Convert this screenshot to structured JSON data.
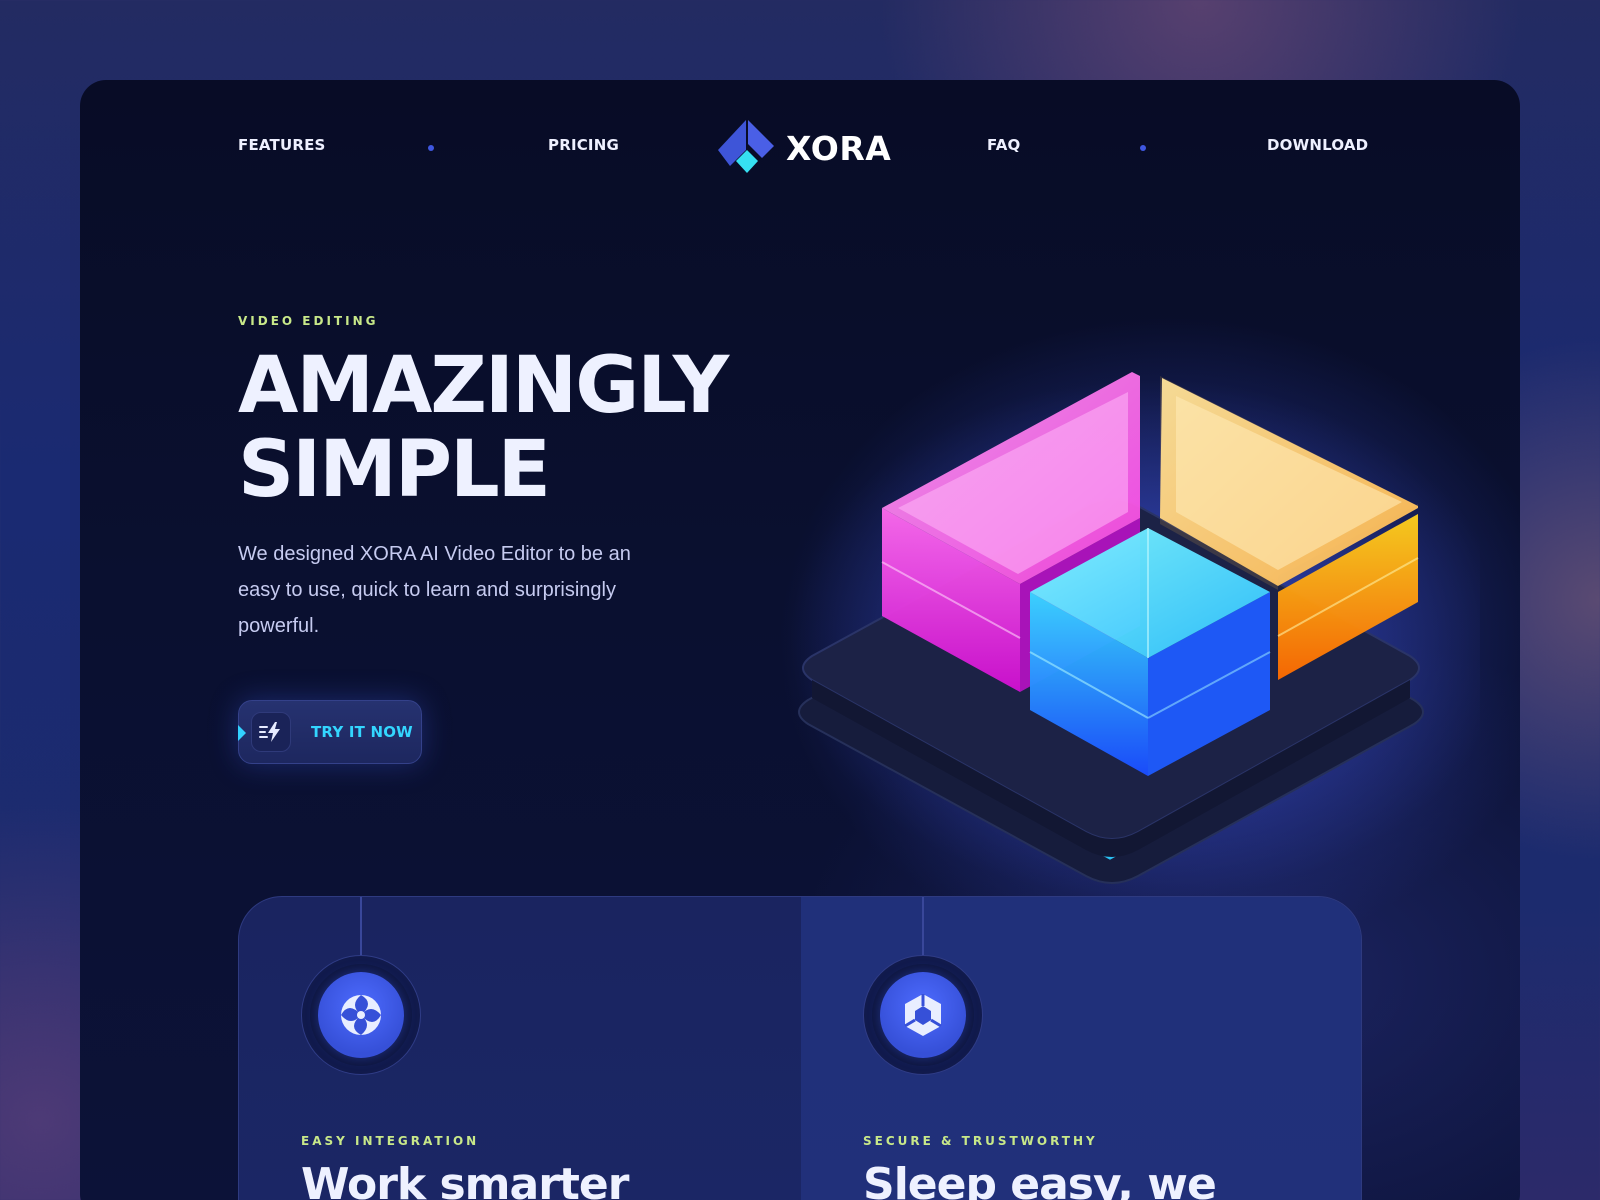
{
  "brand": {
    "name": "XORA",
    "icon": "xora-diamond-logo"
  },
  "nav": {
    "items": [
      {
        "label": "FEATURES"
      },
      {
        "label": "PRICING"
      },
      {
        "label": "FAQ"
      },
      {
        "label": "DOWNLOAD"
      }
    ]
  },
  "hero": {
    "eyebrow": "VIDEO EDITING",
    "title_line1": "AMAZINGLY",
    "title_line2": "SIMPLE",
    "description": "We designed XORA AI Video Editor to be an easy to use, quick to learn and surprisingly powerful.",
    "cta": {
      "label": "TRY IT NOW",
      "icon": "lightning-icon"
    },
    "illustration": "glowing-glass-blocks-3d"
  },
  "features": [
    {
      "eyebrow": "EASY INTEGRATION",
      "title": "Work smarter",
      "icon": "swirl-icon"
    },
    {
      "eyebrow": "SECURE & TRUSTWORTHY",
      "title": "Sleep easy, we",
      "icon": "hexagon-icon"
    }
  ],
  "colors": {
    "accent_cyan": "#33d6ff",
    "eyebrow_green": "#c8e889",
    "brand_blue": "#3f57e0",
    "card_bg": "#080c26"
  }
}
